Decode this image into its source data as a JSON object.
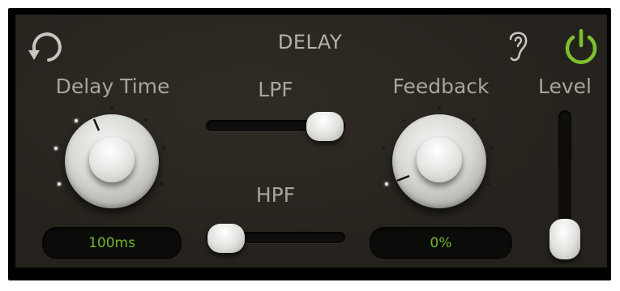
{
  "header": {
    "title": "DELAY",
    "reset_icon": "rotate-ccw-icon",
    "listen_icon": "ear-icon",
    "power_icon": "power-icon",
    "power_color": "#7dc12e"
  },
  "delay_time": {
    "label": "Delay Time",
    "value": "100ms"
  },
  "lpf": {
    "label": "LPF",
    "position": 0.88
  },
  "hpf": {
    "label": "HPF",
    "position": 0.0
  },
  "feedback": {
    "label": "Feedback",
    "value": "0%"
  },
  "level": {
    "label": "Level",
    "position": 0.0
  },
  "colors": {
    "panel_bg": "#2a2620",
    "label": "#a9a59c",
    "readout_text": "#6fb82c"
  }
}
